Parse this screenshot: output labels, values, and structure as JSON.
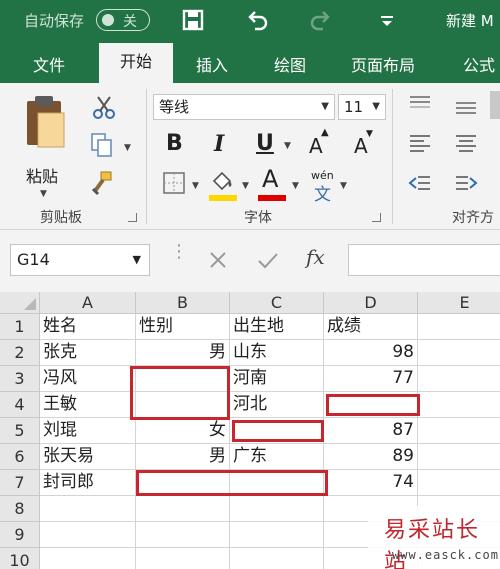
{
  "titlebar": {
    "autosave_label": "自动保存",
    "autosave_state": "关",
    "doc_title": "新建 M"
  },
  "tabs": [
    "文件",
    "开始",
    "插入",
    "绘图",
    "页面布局",
    "公式"
  ],
  "ribbon": {
    "clipboard": {
      "paste_label": "粘贴",
      "group_label": "剪贴板"
    },
    "font": {
      "font_name": "等线",
      "font_size": "11",
      "bold": "B",
      "italic": "I",
      "underline": "U",
      "increase_size": "A",
      "decrease_size": "A",
      "phonetic_top": "wén",
      "phonetic_bottom": "文",
      "group_label": "字体",
      "fill_color": "#ffd700",
      "font_color": "#e00000"
    },
    "alignment": {
      "group_label": "对齐方"
    }
  },
  "formula_bar": {
    "name_box": "G14",
    "fx": "fx",
    "value": ""
  },
  "sheet": {
    "columns": [
      "A",
      "B",
      "C",
      "D",
      "E"
    ],
    "rows": [
      "1",
      "2",
      "3",
      "4",
      "5",
      "6",
      "7",
      "8",
      "9",
      "10"
    ],
    "cells": [
      [
        "姓名",
        "性别",
        "出生地",
        "成绩",
        ""
      ],
      [
        "张克",
        "男",
        "山东",
        "98",
        ""
      ],
      [
        "冯风",
        "",
        "河南",
        "77",
        ""
      ],
      [
        "王敏",
        "",
        "河北",
        "",
        ""
      ],
      [
        "刘琨",
        "女",
        "",
        "87",
        ""
      ],
      [
        "张天易",
        "男",
        "广东",
        "89",
        ""
      ],
      [
        "封司郎",
        "",
        "",
        "74",
        ""
      ],
      [
        "",
        "",
        "",
        "",
        ""
      ],
      [
        "",
        "",
        "",
        "",
        ""
      ],
      [
        "",
        "",
        "",
        "",
        ""
      ]
    ],
    "highlight_color": "#c8262f"
  },
  "watermark": {
    "text": "易采站长站",
    "url": "www.easck.com"
  }
}
